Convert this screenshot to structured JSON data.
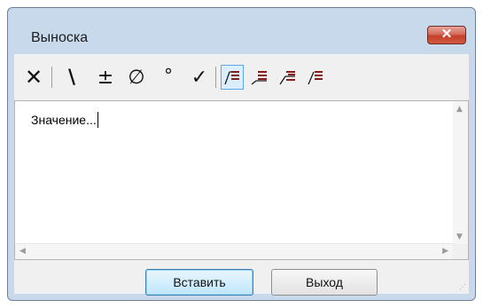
{
  "window": {
    "title": "Выноска",
    "close_label": "✕"
  },
  "toolbar": {
    "items": [
      {
        "name": "delete",
        "glyph": "✕"
      },
      {
        "name": "backslash",
        "glyph": "\\"
      },
      {
        "name": "plus-minus",
        "glyph": "±"
      },
      {
        "name": "diameter",
        "glyph": "∅"
      },
      {
        "name": "degree",
        "glyph": "°"
      },
      {
        "name": "check",
        "glyph": "✓"
      }
    ],
    "alignment_selected": "align-left-leader"
  },
  "editor": {
    "value": "Значение..."
  },
  "buttons": {
    "insert": "Вставить",
    "exit": "Выход"
  },
  "colors": {
    "accent": "#3c7fb1",
    "align_lines": "#8b1a1a",
    "close": "#c2412c"
  }
}
